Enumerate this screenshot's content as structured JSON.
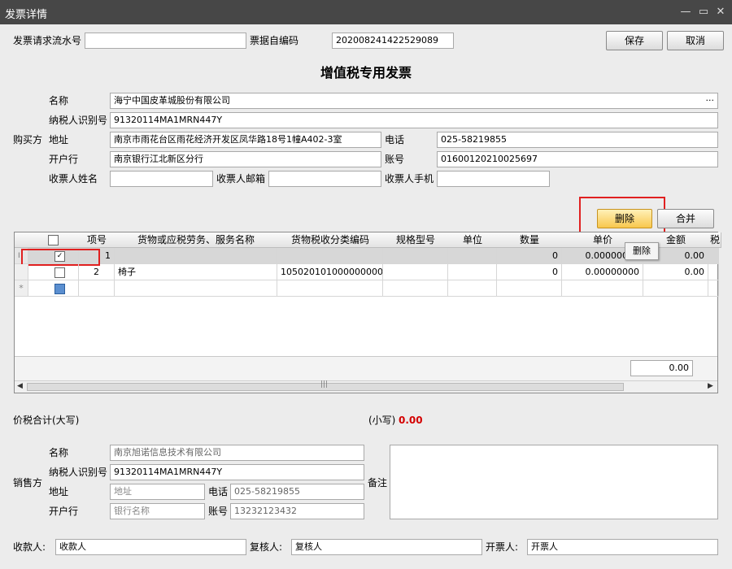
{
  "window": {
    "title": "发票详情"
  },
  "header": {
    "serial_label": "发票请求流水号",
    "serial_value": "",
    "code_label": "票据自编码",
    "code_value": "202008241422529089",
    "save_label": "保存",
    "cancel_label": "取消"
  },
  "invoice_title": "增值税专用发票",
  "buyer": {
    "section_label": "购买方",
    "name_label": "名称",
    "name_value": "海宁中国皮革城股份有限公司",
    "more_glyph": "···",
    "taxid_label": "纳税人识别号",
    "taxid_value": "91320114MA1MRN447Y",
    "address_label": "地址",
    "address_value": "南京市雨花台区雨花经济开发区凤华路18号1幢A402-3室",
    "phone_label": "电话",
    "phone_value": "025-58219855",
    "bank_label": "开户行",
    "bank_value": "南京银行江北新区分行",
    "account_label": "账号",
    "account_value": "01600120210025697",
    "receiver_name_label": "收票人姓名",
    "receiver_name_value": "",
    "receiver_email_label": "收票人邮箱",
    "receiver_email_value": "",
    "receiver_phone_label": "收票人手机",
    "receiver_phone_value": ""
  },
  "grid_toolbar": {
    "delete_label": "删除",
    "merge_label": "合并",
    "tooltip": "删除"
  },
  "grid": {
    "columns": [
      "项号",
      "货物或应税劳务、服务名称",
      "货物税收分类编码",
      "规格型号",
      "单位",
      "数量",
      "单价",
      "金额",
      "税"
    ],
    "rows": [
      {
        "no": "1",
        "name": "",
        "code": "",
        "spec": "",
        "unit": "",
        "qty": "0",
        "price": "0.00000000",
        "amount": "0.00",
        "checked": true
      },
      {
        "no": "2",
        "name": "椅子",
        "code": "1050201010000000000",
        "spec": "",
        "unit": "",
        "qty": "0",
        "price": "0.00000000",
        "amount": "0.00",
        "checked": false
      }
    ],
    "new_row_marker": "*",
    "current_row_marker": "I",
    "total_amount": "0.00"
  },
  "totals": {
    "upper_label": "价税合计(大写)",
    "lower_label": "(小写)",
    "lower_value": "0.00"
  },
  "seller": {
    "section_label": "销售方",
    "name_label": "名称",
    "name_value": "南京旭诺信息技术有限公司",
    "taxid_label": "纳税人识别号",
    "taxid_value": "91320114MA1MRN447Y",
    "address_label": "地址",
    "address_placeholder": "地址",
    "phone_label": "电话",
    "phone_value": "025-58219855",
    "bank_label": "开户行",
    "bank_placeholder": "银行名称",
    "account_label": "账号",
    "account_value": "13232123432",
    "remark_label": "备注",
    "remark_value": ""
  },
  "footer": {
    "payee_label": "收款人:",
    "payee_value": "收款人",
    "reviewer_label": "复核人:",
    "reviewer_value": "复核人",
    "drawer_label": "开票人:",
    "drawer_value": "开票人"
  },
  "colors": {
    "titlebar": "#474747",
    "highlight_box": "#e02020",
    "total_red": "#d40000"
  }
}
